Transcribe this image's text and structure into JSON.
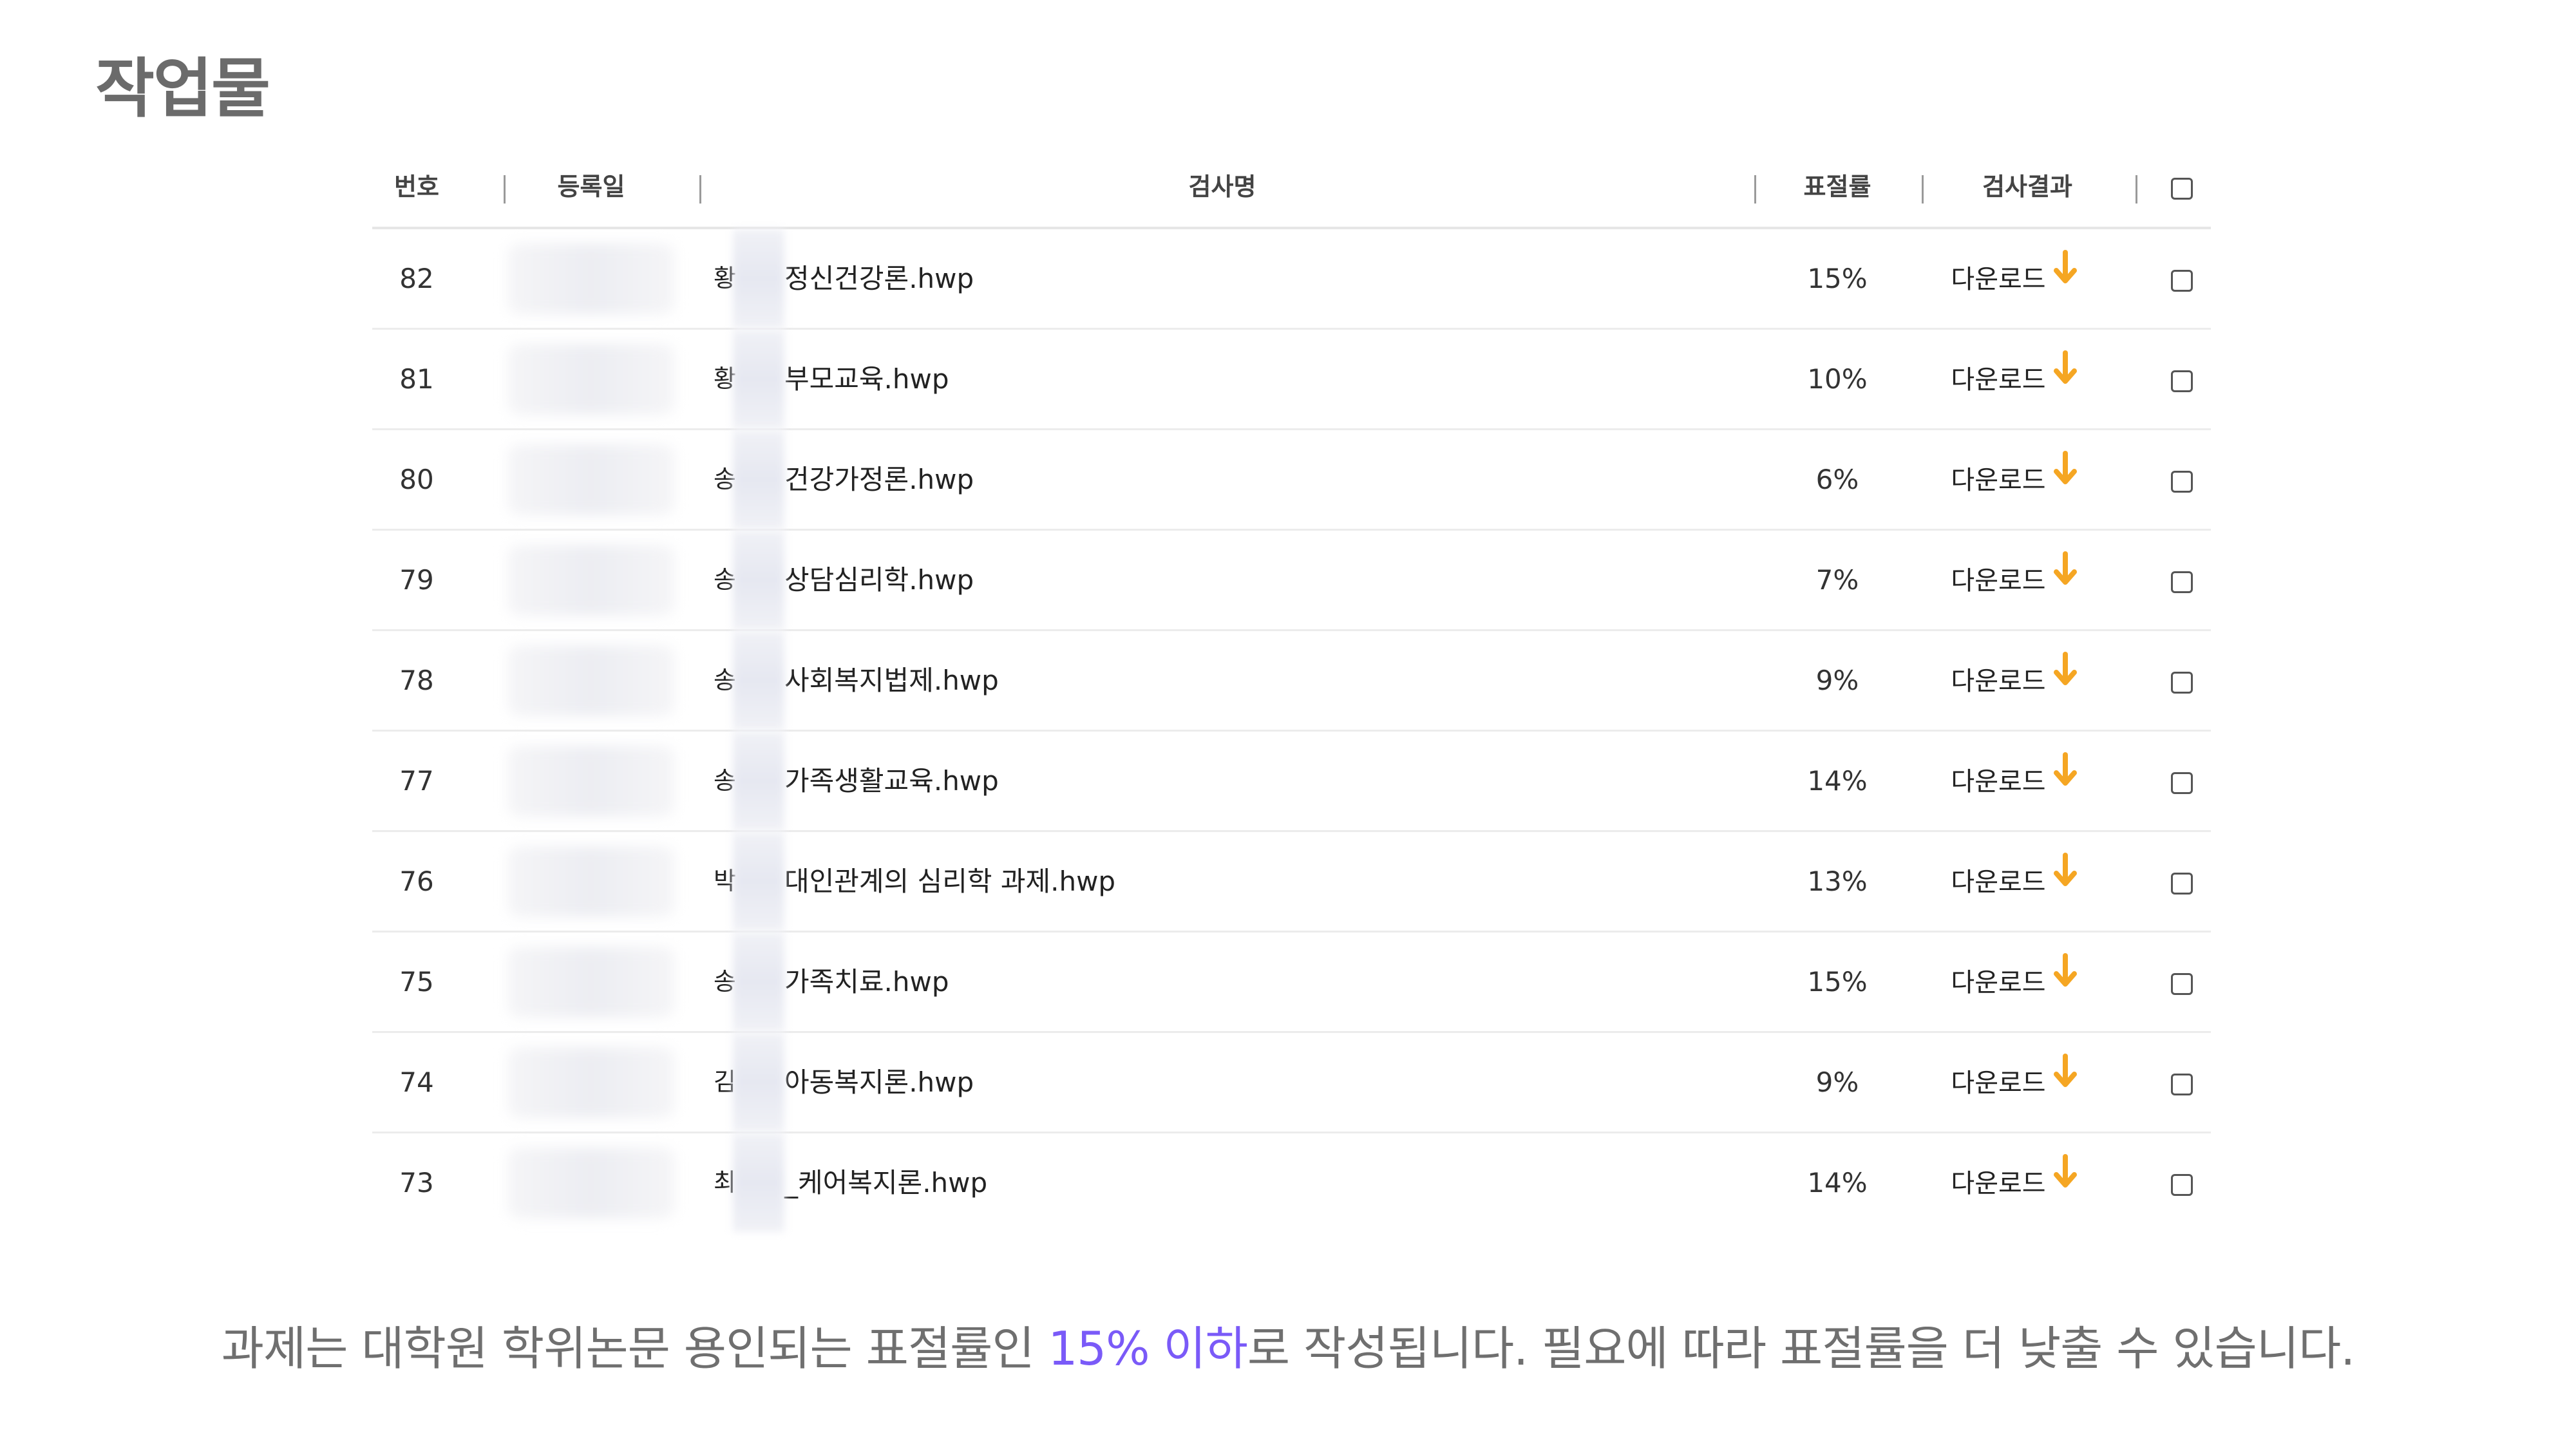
{
  "page": {
    "title": "작업물"
  },
  "table": {
    "headers": {
      "number": "번호",
      "date": "등록일",
      "name": "검사명",
      "rate": "표절률",
      "result": "검사결과"
    },
    "rows": [
      {
        "number": "82",
        "initial": "황",
        "name": "정신건강론.hwp",
        "rate": "15%",
        "download": "다운로드"
      },
      {
        "number": "81",
        "initial": "황",
        "name": "부모교육.hwp",
        "rate": "10%",
        "download": "다운로드"
      },
      {
        "number": "80",
        "initial": "송",
        "name": "건강가정론.hwp",
        "rate": "6%",
        "download": "다운로드"
      },
      {
        "number": "79",
        "initial": "송",
        "name": "상담심리학.hwp",
        "rate": "7%",
        "download": "다운로드"
      },
      {
        "number": "78",
        "initial": "송",
        "name": "사회복지법제.hwp",
        "rate": "9%",
        "download": "다운로드"
      },
      {
        "number": "77",
        "initial": "송",
        "name": "가족생활교육.hwp",
        "rate": "14%",
        "download": "다운로드"
      },
      {
        "number": "76",
        "initial": "박",
        "name": "대인관계의 심리학 과제.hwp",
        "rate": "13%",
        "download": "다운로드"
      },
      {
        "number": "75",
        "initial": "송",
        "name": "가족치료.hwp",
        "rate": "15%",
        "download": "다운로드"
      },
      {
        "number": "74",
        "initial": "김",
        "name": "아동복지론.hwp",
        "rate": "9%",
        "download": "다운로드"
      },
      {
        "number": "73",
        "initial": "최",
        "name": "_케어복지론.hwp",
        "rate": "14%",
        "download": "다운로드"
      }
    ]
  },
  "caption": {
    "before": "과제는 대학원 학위논문 용인되는 표절률인 ",
    "highlight": "15% 이하",
    "after": "로 작성됩니다. 필요에 따라 표절률을 더 낮출 수 있습니다."
  },
  "colors": {
    "accent_arrow": "#f5a623",
    "caption_highlight": "#7a5af8"
  },
  "icons": {
    "download": "arrow-down-icon",
    "select": "checkbox-icon"
  }
}
